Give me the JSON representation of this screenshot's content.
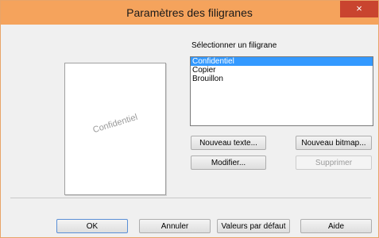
{
  "window": {
    "title": "Paramètres des filigranes",
    "close_glyph": "×"
  },
  "preview": {
    "watermark_text": "Confidentiel"
  },
  "watermark_list": {
    "label": "Sélectionner un filigrane",
    "items": [
      "Confidentiel",
      "Copier",
      "Brouillon"
    ],
    "selected": "Confidentiel"
  },
  "buttons": {
    "new_text": "Nouveau texte...",
    "new_bitmap": "Nouveau bitmap...",
    "modify": "Modifier...",
    "delete": "Supprimer",
    "ok": "OK",
    "cancel": "Annuler",
    "defaults": "Valeurs par défaut",
    "help": "Aide"
  },
  "colors": {
    "titlebar": "#f5a35c",
    "close_button": "#c9442f",
    "selection": "#3399ff"
  }
}
